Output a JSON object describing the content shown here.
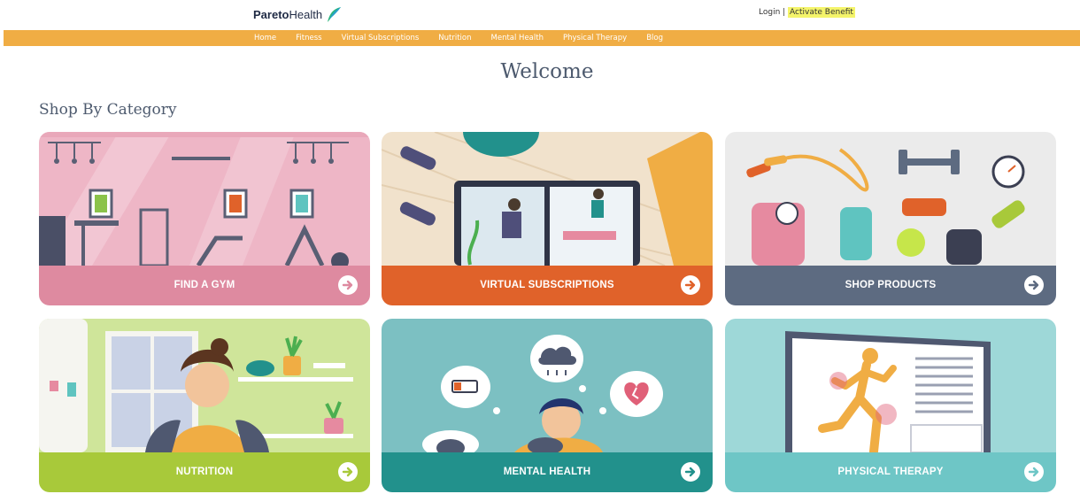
{
  "header": {
    "logo_bold": "Pareto",
    "logo_light": "Health",
    "login_label": "Login",
    "separator": " | ",
    "activate_label": "Activate Benefit"
  },
  "nav": {
    "items": [
      "Home",
      "Fitness",
      "Virtual Subscriptions",
      "Nutrition",
      "Mental Health",
      "Physical Therapy",
      "Blog"
    ]
  },
  "main": {
    "title": "Welcome",
    "section_title": "Shop By Category"
  },
  "categories": [
    {
      "label": "FIND A GYM",
      "color": "#de8aa0"
    },
    {
      "label": "VIRTUAL SUBSCRIPTIONS",
      "color": "#e0622a"
    },
    {
      "label": "SHOP PRODUCTS",
      "color": "#5d6b81"
    },
    {
      "label": "NUTRITION",
      "color": "#a8c93a"
    },
    {
      "label": "MENTAL HEALTH",
      "color": "#22918c"
    },
    {
      "label": "PHYSICAL THERAPY",
      "color": "#6ec6c6"
    }
  ],
  "colors": {
    "nav_bg": "#f0ad44",
    "heading": "#4d5a6e",
    "highlight": "#f4f46a"
  }
}
